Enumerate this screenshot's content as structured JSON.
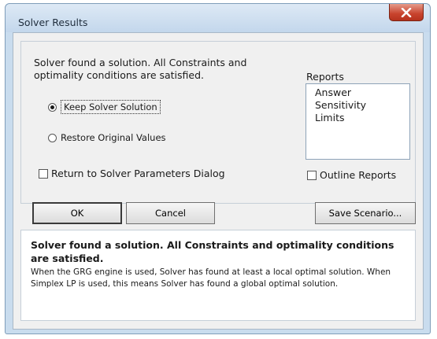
{
  "window": {
    "title": "Solver Results"
  },
  "message": "Solver found a solution.  All Constraints and optimality conditions are satisfied.",
  "reports": {
    "label": "Reports",
    "items": [
      "Answer",
      "Sensitivity",
      "Limits"
    ]
  },
  "options": {
    "keep_label": "Keep Solver Solution",
    "keep_selected": true,
    "restore_label": "Restore Original Values",
    "restore_selected": false
  },
  "checkboxes": {
    "return_label": "Return to Solver Parameters Dialog",
    "return_checked": false,
    "outline_label": "Outline Reports",
    "outline_checked": false
  },
  "buttons": {
    "ok": "OK",
    "cancel": "Cancel",
    "save": "Save Scenario..."
  },
  "info": {
    "title": "Solver found a solution.  All Constraints and optimality conditions are satisfied.",
    "body": "When the GRG engine is used, Solver has found at least a local optimal solution. When Simplex LP is used, this means Solver has found a global optimal solution."
  },
  "icons": {
    "close": "close-icon"
  }
}
